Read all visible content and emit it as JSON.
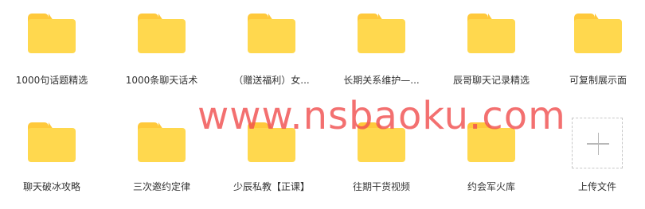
{
  "folders": [
    {
      "label": "1000句话题精选"
    },
    {
      "label": "1000条聊天话术"
    },
    {
      "label": "（赠送福利）女..."
    },
    {
      "label": "长期关系维护—..."
    },
    {
      "label": "辰哥聊天记录精选"
    },
    {
      "label": "可复制展示面"
    },
    {
      "label": "聊天破冰攻略"
    },
    {
      "label": "三次邀约定律"
    },
    {
      "label": "少辰私教【正课】"
    },
    {
      "label": "往期干货视频"
    },
    {
      "label": "约会军火库"
    }
  ],
  "upload": {
    "label": "上传文件",
    "icon": "plus-icon"
  },
  "watermark": {
    "text": "www.nsbaoku.com"
  },
  "colors": {
    "folder": "#FFD84E",
    "folder_tab": "#FFC93B",
    "watermark": "#F05050"
  }
}
